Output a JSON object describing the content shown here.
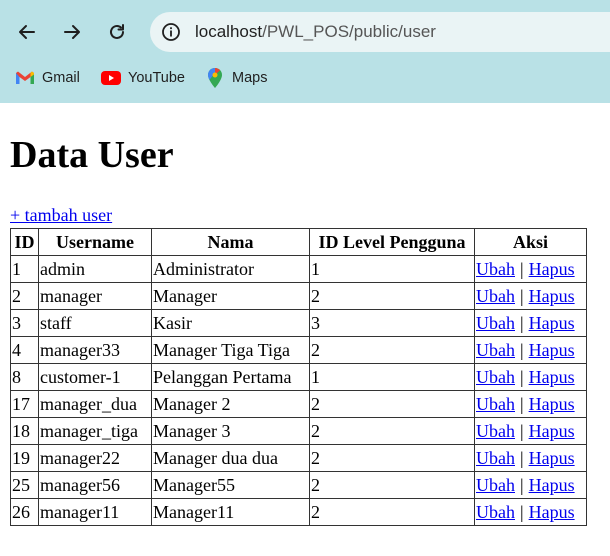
{
  "browser": {
    "url_host": "localhost",
    "url_path": "/PWL_POS/public/user",
    "bookmarks": [
      {
        "label": "Gmail",
        "icon": "gmail-icon"
      },
      {
        "label": "YouTube",
        "icon": "youtube-icon"
      },
      {
        "label": "Maps",
        "icon": "maps-icon"
      }
    ]
  },
  "page": {
    "title": "Data User",
    "add_link": "+ tambah user"
  },
  "table": {
    "headers": [
      "ID",
      "Username",
      "Nama",
      "ID Level Pengguna",
      "Aksi"
    ],
    "edit_label": "Ubah",
    "separator": "|",
    "delete_label": "Hapus",
    "rows": [
      {
        "id": "1",
        "username": "admin",
        "nama": "Administrator",
        "level": "1"
      },
      {
        "id": "2",
        "username": "manager",
        "nama": "Manager",
        "level": "2"
      },
      {
        "id": "3",
        "username": "staff",
        "nama": "Kasir",
        "level": "3"
      },
      {
        "id": "4",
        "username": "manager33",
        "nama": "Manager Tiga Tiga",
        "level": "2"
      },
      {
        "id": "8",
        "username": "customer-1",
        "nama": "Pelanggan Pertama",
        "level": "1"
      },
      {
        "id": "17",
        "username": "manager_dua",
        "nama": "Manager 2",
        "level": "2"
      },
      {
        "id": "18",
        "username": "manager_tiga",
        "nama": "Manager 3",
        "level": "2"
      },
      {
        "id": "19",
        "username": "manager22",
        "nama": "Manager dua dua",
        "level": "2"
      },
      {
        "id": "25",
        "username": "manager56",
        "nama": "Manager55",
        "level": "2"
      },
      {
        "id": "26",
        "username": "manager11",
        "nama": "Manager11",
        "level": "2"
      }
    ]
  }
}
